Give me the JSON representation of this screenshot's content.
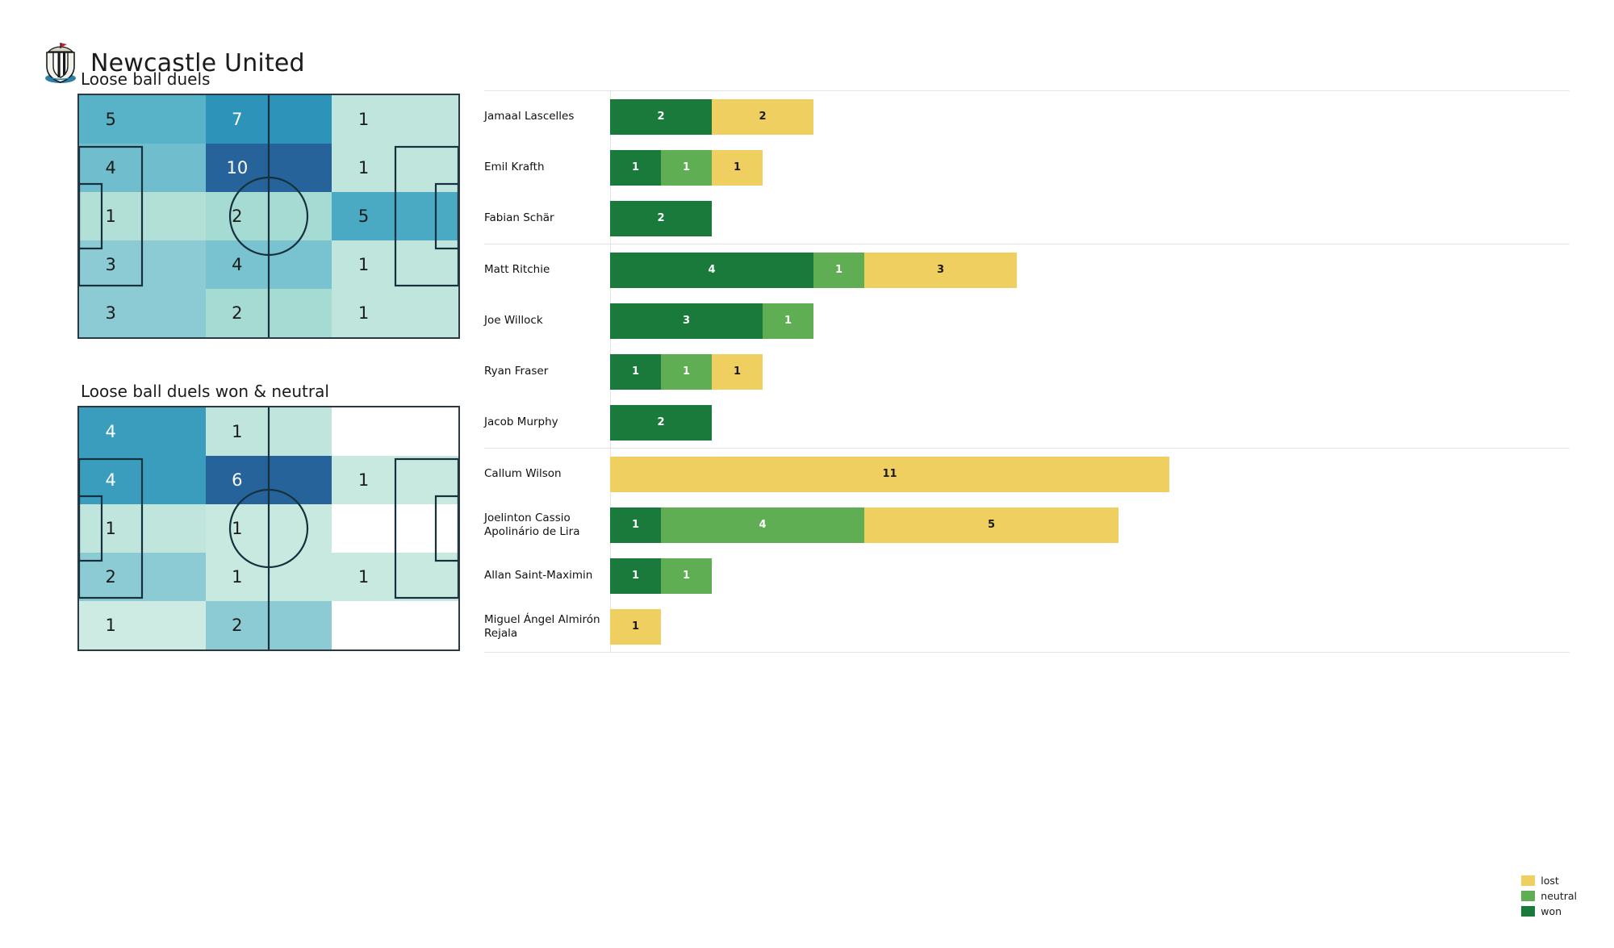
{
  "header": {
    "team": "Newcastle United",
    "crest_icon": "newcastle-united-crest-icon"
  },
  "pitches": [
    {
      "id": "loose-ball-duels",
      "title": "Loose ball duels",
      "rows": 5,
      "cols": 3,
      "cells": [
        [
          {
            "value": "5",
            "color": "#58b2c8",
            "text": "light"
          },
          {
            "value": "7",
            "color": "#2e93b8",
            "text": "dark"
          },
          {
            "value": "1",
            "color": "#bfe5dc",
            "text": "light"
          }
        ],
        [
          {
            "value": "4",
            "color": "#6fbdcd",
            "text": "light"
          },
          {
            "value": "10",
            "color": "#25639a",
            "text": "dark"
          },
          {
            "value": "1",
            "color": "#bfe5dc",
            "text": "light"
          }
        ],
        [
          {
            "value": "1",
            "color": "#b3e0d6",
            "text": "light"
          },
          {
            "value": "2",
            "color": "#a5dbd2",
            "text": "light"
          },
          {
            "value": "5",
            "color": "#4aa9c3",
            "text": "light"
          }
        ],
        [
          {
            "value": "3",
            "color": "#8ccbd3",
            "text": "light"
          },
          {
            "value": "4",
            "color": "#79c2cf",
            "text": "light"
          },
          {
            "value": "1",
            "color": "#bfe5dc",
            "text": "light"
          }
        ],
        [
          {
            "value": "3",
            "color": "#8ccbd3",
            "text": "light"
          },
          {
            "value": "2",
            "color": "#a5dbd2",
            "text": "light"
          },
          {
            "value": "1",
            "color": "#bfe5dc",
            "text": "light"
          }
        ]
      ]
    },
    {
      "id": "loose-ball-duels-won-neutral",
      "title": "Loose ball duels won & neutral",
      "rows": 5,
      "cols": 3,
      "cells": [
        [
          {
            "value": "4",
            "color": "#3a9dbe",
            "text": "dark"
          },
          {
            "value": "1",
            "color": "#bfe5dc",
            "text": "light"
          },
          {
            "value": "",
            "color": "#ffffff",
            "text": "light"
          }
        ],
        [
          {
            "value": "4",
            "color": "#3a9dbe",
            "text": "dark"
          },
          {
            "value": "6",
            "color": "#25639a",
            "text": "dark"
          },
          {
            "value": "1",
            "color": "#c8e9e0",
            "text": "light"
          }
        ],
        [
          {
            "value": "1",
            "color": "#bfe5dc",
            "text": "light"
          },
          {
            "value": "1",
            "color": "#c8e9e0",
            "text": "light"
          },
          {
            "value": "",
            "color": "#ffffff",
            "text": "light"
          }
        ],
        [
          {
            "value": "2",
            "color": "#8ccbd3",
            "text": "light"
          },
          {
            "value": "1",
            "color": "#c8e9e0",
            "text": "light"
          },
          {
            "value": "1",
            "color": "#c8e9e0",
            "text": "light"
          }
        ],
        [
          {
            "value": "1",
            "color": "#cdebe2",
            "text": "light"
          },
          {
            "value": "2",
            "color": "#8ccbd3",
            "text": "light"
          },
          {
            "value": "",
            "color": "#ffffff",
            "text": "light"
          }
        ]
      ]
    }
  ],
  "chart_data": {
    "type": "bar",
    "orientation": "horizontal",
    "stacked": true,
    "title": "",
    "xlabel": "",
    "ylabel": "",
    "xlim": [
      0,
      11
    ],
    "grid": false,
    "legend_position": "bottom-right",
    "series": [
      {
        "name": "won",
        "color": "#1a7a3c"
      },
      {
        "name": "neutral",
        "color": "#5fae53"
      },
      {
        "name": "lost",
        "color": "#f0cf61"
      }
    ],
    "groups": [
      {
        "rows": [
          {
            "player": "Jamaal Lascelles",
            "won": 2,
            "neutral": 0,
            "lost": 2
          },
          {
            "player": "Emil Krafth",
            "won": 1,
            "neutral": 1,
            "lost": 1
          },
          {
            "player": "Fabian Schär",
            "won": 2,
            "neutral": 0,
            "lost": 0
          }
        ]
      },
      {
        "rows": [
          {
            "player": "Matt Ritchie",
            "won": 4,
            "neutral": 1,
            "lost": 3
          },
          {
            "player": "Joe Willock",
            "won": 3,
            "neutral": 1,
            "lost": 0
          },
          {
            "player": "Ryan Fraser",
            "won": 1,
            "neutral": 1,
            "lost": 1
          },
          {
            "player": "Jacob Murphy",
            "won": 2,
            "neutral": 0,
            "lost": 0
          }
        ]
      },
      {
        "rows": [
          {
            "player": "Callum Wilson",
            "won": 0,
            "neutral": 0,
            "lost": 11
          },
          {
            "player": "Joelinton Cassio Apolinário de Lira",
            "won": 1,
            "neutral": 4,
            "lost": 5
          },
          {
            "player": "Allan Saint-Maximin",
            "won": 1,
            "neutral": 1,
            "lost": 0
          },
          {
            "player": "Miguel Ángel Almirón Rejala",
            "won": 0,
            "neutral": 0,
            "lost": 1
          }
        ]
      }
    ]
  },
  "legend": {
    "items": [
      {
        "label": "lost",
        "color": "#f0cf61"
      },
      {
        "label": "neutral",
        "color": "#5fae53"
      },
      {
        "label": "won",
        "color": "#1a7a3c"
      }
    ]
  }
}
